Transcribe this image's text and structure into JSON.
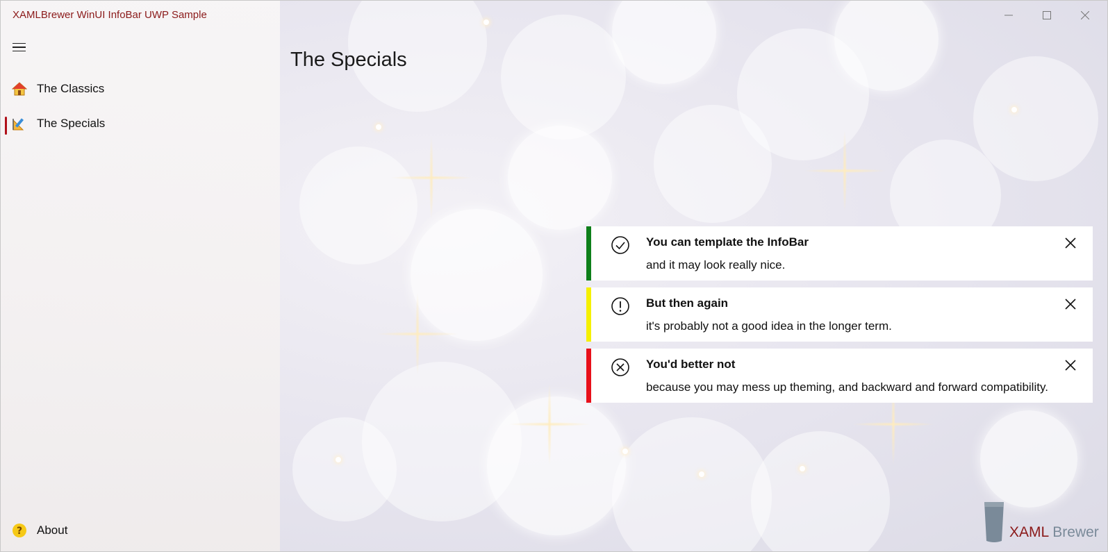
{
  "window": {
    "title": "XAMLBrewer WinUI InfoBar UWP Sample",
    "controls": {
      "minimize_icon": "minimize-icon",
      "maximize_icon": "maximize-icon",
      "close_icon": "close-icon"
    }
  },
  "nav": {
    "menu_icon": "hamburger-icon",
    "items": [
      {
        "label": "The Classics",
        "icon": "house-icon",
        "selected": false
      },
      {
        "label": "The Specials",
        "icon": "drafting-icon",
        "selected": true
      }
    ],
    "footer": {
      "label": "About",
      "icon": "help-icon"
    }
  },
  "main": {
    "page_title": "The Specials",
    "infobars": [
      {
        "title": "You can template the InfoBar",
        "message": "and it may look really nice.",
        "severity": "success",
        "accent_color": "#0e7f1a",
        "icon": "check-circle-icon"
      },
      {
        "title": "But then again",
        "message": "it's probably not a good idea in the longer term.",
        "severity": "warning",
        "accent_color": "#f5f000",
        "icon": "exclamation-circle-icon"
      },
      {
        "title": "You'd better not",
        "message": "because you may mess up theming, and backward and forward compatibility.",
        "severity": "error",
        "accent_color": "#e8101a",
        "icon": "x-circle-icon"
      }
    ]
  },
  "branding": {
    "logo_word1": "XAML",
    "logo_word2": "Brewer"
  },
  "colors": {
    "title_text": "#8b1a1a",
    "selection_indicator": "#b0101a",
    "logo_grey": "#7a8a99"
  }
}
